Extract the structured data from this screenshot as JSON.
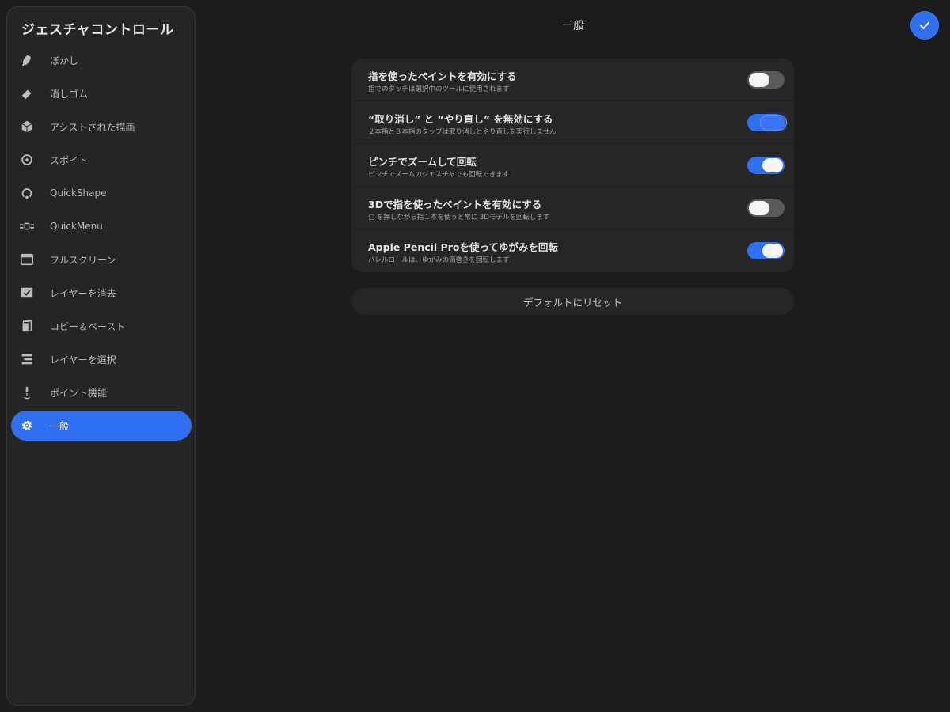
{
  "sidebar": {
    "title": "ジェスチャコントロール",
    "items": [
      {
        "label": "ぼかし",
        "icon": "smudge-icon"
      },
      {
        "label": "消しゴム",
        "icon": "eraser-icon"
      },
      {
        "label": "アシストされた描画",
        "icon": "cube-icon"
      },
      {
        "label": "スポイト",
        "icon": "eyedropper-icon"
      },
      {
        "label": "QuickShape",
        "icon": "quickshape-icon"
      },
      {
        "label": "QuickMenu",
        "icon": "quickmenu-icon"
      },
      {
        "label": "フルスクリーン",
        "icon": "fullscreen-icon"
      },
      {
        "label": "レイヤーを消去",
        "icon": "clear-layer-icon"
      },
      {
        "label": "コピー＆ペースト",
        "icon": "copy-paste-icon"
      },
      {
        "label": "レイヤーを選択",
        "icon": "layers-icon"
      },
      {
        "label": "ポイント機能",
        "icon": "pointer-icon"
      },
      {
        "label": "一般",
        "icon": "gear-icon",
        "active": true
      }
    ]
  },
  "main": {
    "title": "一般",
    "settings": [
      {
        "title": "指を使ったペイントを有効にする",
        "description": "指でのタッチは選択中のツールに使用されます",
        "enabled": false
      },
      {
        "title": "“取り消し” と “やり直し” を無効にする",
        "description": "２本指と３本指のタップは取り消しとやり直しを実行しません",
        "enabled": true
      },
      {
        "title": "ピンチでズームして回転",
        "description": "ピンチでズームのジェスチャでも回転できます",
        "enabled": true
      },
      {
        "title": "3Dで指を使ったペイントを有効にする",
        "description": "▢ を押しながら指１本を使うと常に 3Dモデルを回転します",
        "enabled": false
      },
      {
        "title": "Apple Pencil Proを使ってゆがみを回転",
        "description": "バレルロールは、ゆがみの渦巻きを回転します",
        "enabled": true
      }
    ],
    "reset_label": "デフォルトにリセット"
  },
  "colors": {
    "accent": "#2f6ff2",
    "background": "#1c1c1c",
    "panel": "#262626"
  }
}
